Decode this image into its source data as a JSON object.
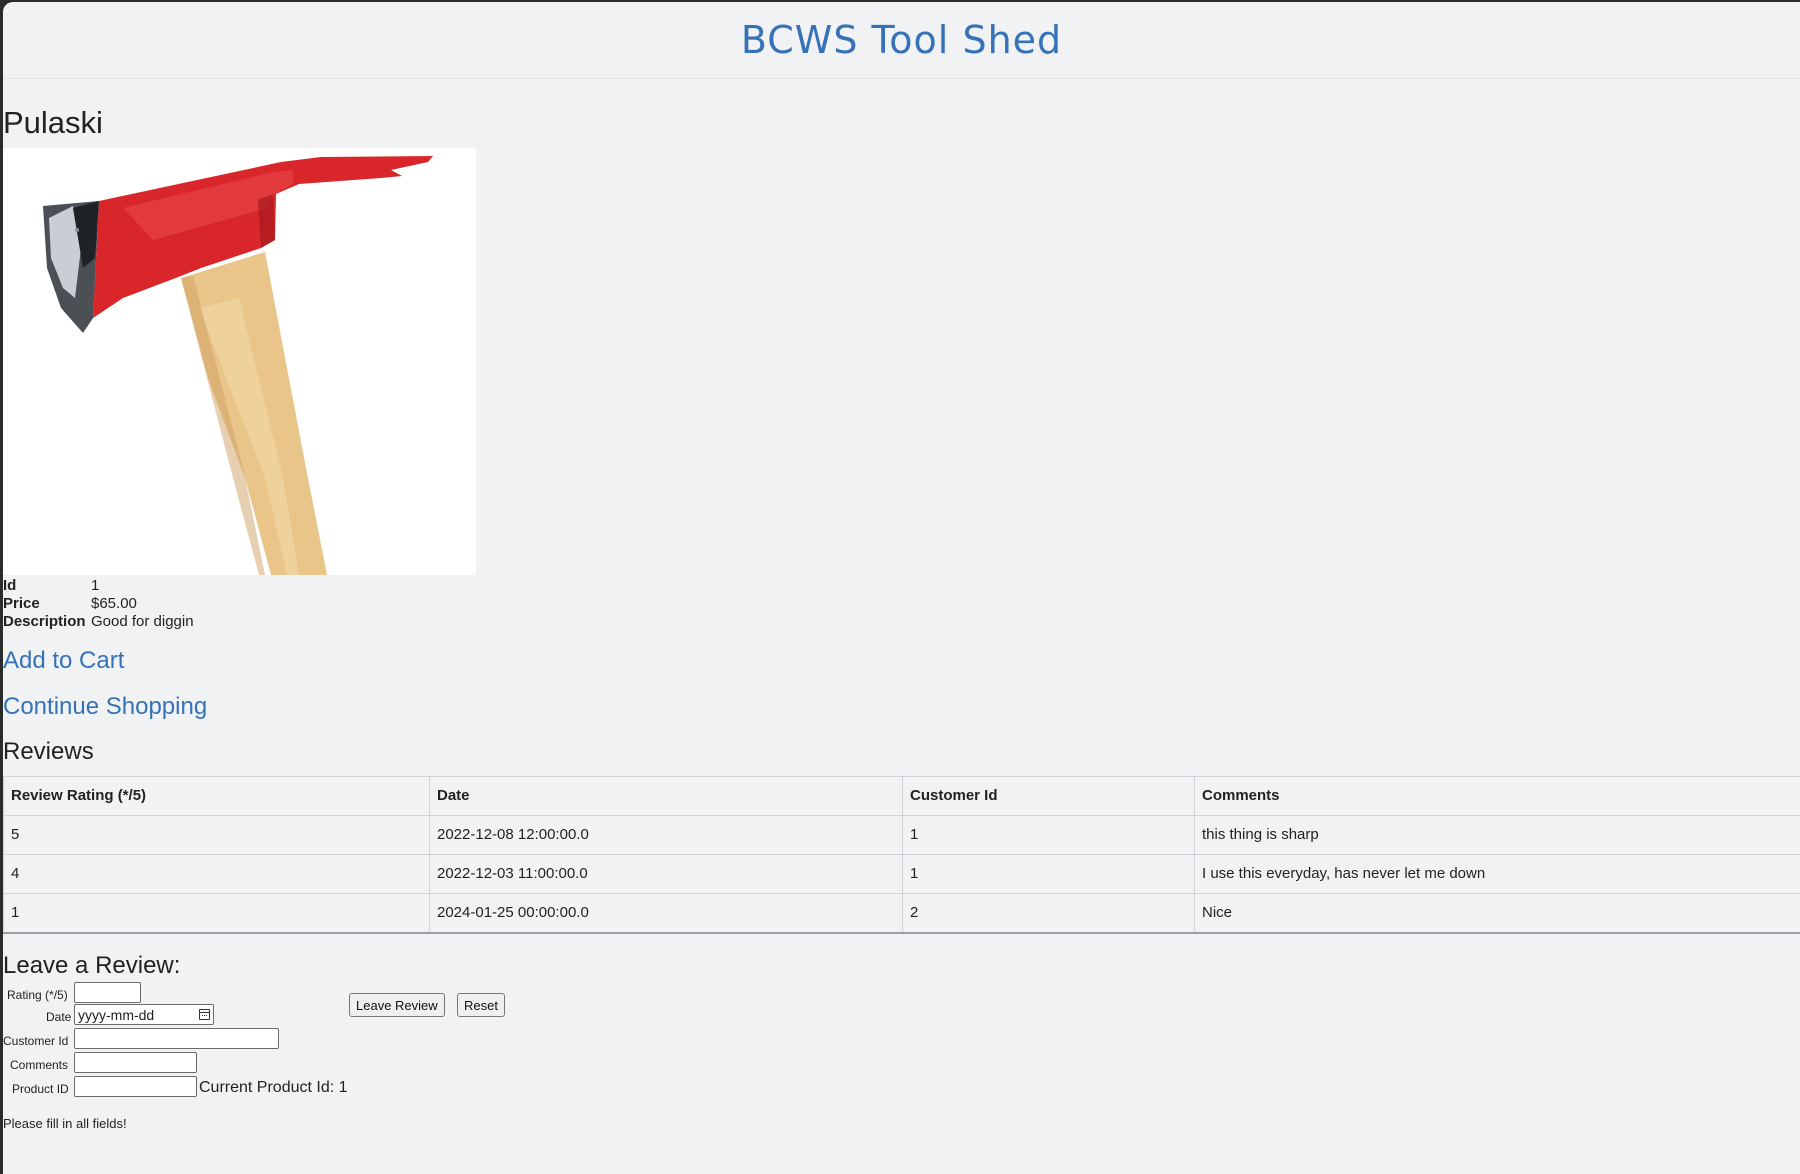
{
  "header": {
    "title": "BCWS Tool Shed"
  },
  "product": {
    "name": "Pulaski",
    "image_icon": "pulaski-axe-image",
    "details": [
      {
        "key": "Id",
        "value": "1"
      },
      {
        "key": "Price",
        "value": "$65.00"
      },
      {
        "key": "Description",
        "value": "Good for diggin"
      }
    ]
  },
  "links": {
    "add_to_cart": "Add to Cart",
    "continue_shopping": "Continue Shopping"
  },
  "reviews": {
    "title": "Reviews",
    "columns": [
      "Review Rating (*/5)",
      "Date",
      "Customer Id",
      "Comments"
    ],
    "rows": [
      [
        "5",
        "2022-12-08 12:00:00.0",
        "1",
        "this thing is sharp"
      ],
      [
        "4",
        "2022-12-03 11:00:00.0",
        "1",
        "I use this everyday, has never let me down"
      ],
      [
        "1",
        "2024-01-25 00:00:00.0",
        "2",
        "Nice"
      ]
    ]
  },
  "review_form": {
    "title": "Leave a Review:",
    "rating_label": "Rating (*/5)",
    "date_label": "Date",
    "date_placeholder": "yyyy-mm-dd",
    "customer_id_label": "Customer Id",
    "comments_label": "Comments",
    "product_id_label": "Product ID",
    "current_product_text": "Current Product Id: 1",
    "submit_label": "Leave Review",
    "reset_label": "Reset",
    "validation_message": "Please fill in all fields!"
  },
  "colors": {
    "brand": "#3672b8",
    "background": "#f1f2f4",
    "axe_head": "#d8262a",
    "axe_handle": "#e9c58a"
  }
}
